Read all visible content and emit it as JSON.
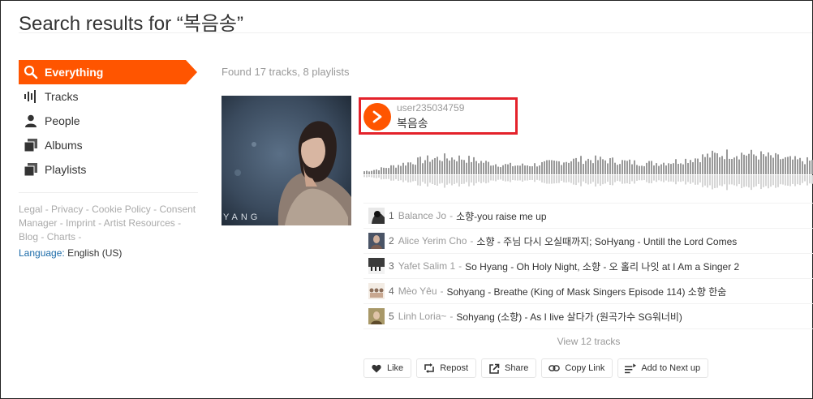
{
  "header": {
    "title": "Search results for “복음송”"
  },
  "sidebar": {
    "items": [
      {
        "label": "Everything",
        "icon": "search-icon",
        "active": true
      },
      {
        "label": "Tracks",
        "icon": "waveform-icon",
        "active": false
      },
      {
        "label": "People",
        "icon": "person-icon",
        "active": false
      },
      {
        "label": "Albums",
        "icon": "album-icon",
        "active": false
      },
      {
        "label": "Playlists",
        "icon": "playlist-icon",
        "active": false
      }
    ],
    "footer_links": [
      "Legal",
      "Privacy",
      "Cookie Policy",
      "Consent Manager",
      "Imprint",
      "Artist Resources",
      "Blog",
      "Charts"
    ],
    "language_label": "Language:",
    "language_value": "English (US)"
  },
  "results": {
    "summary": "Found 17 tracks, 8 playlists",
    "playlist": {
      "artwork_text": "YANG",
      "uploader": "user235034759",
      "title": "복음송",
      "tracks": [
        {
          "num": "1",
          "artist": "Balance Jo",
          "title": "소향-you raise me up"
        },
        {
          "num": "2",
          "artist": "Alice Yerim Cho",
          "title": "소향 - 주님 다시 오실때까지; SoHyang - Untill the Lord Comes"
        },
        {
          "num": "3",
          "artist": "Yafet Salim 1",
          "title": "So Hyang - Oh Holy Night, 소향 - 오 홀리 나잇 at I Am a Singer 2"
        },
        {
          "num": "4",
          "artist": "Mèo Yêu",
          "title": "Sohyang - Breathe (King of Mask Singers Episode 114) 소향 한숨"
        },
        {
          "num": "5",
          "artist": "Linh Loria~",
          "title": "Sohyang (소향) - As I live 살다가 (원곡가수 SG워너비)"
        }
      ],
      "view_more": "View 12 tracks",
      "actions": {
        "like": "Like",
        "repost": "Repost",
        "share": "Share",
        "copy_link": "Copy Link",
        "add_next": "Add to Next up"
      }
    }
  },
  "colors": {
    "accent": "#ff5500",
    "highlight": "#e4222b",
    "link": "#1a6aa8"
  }
}
